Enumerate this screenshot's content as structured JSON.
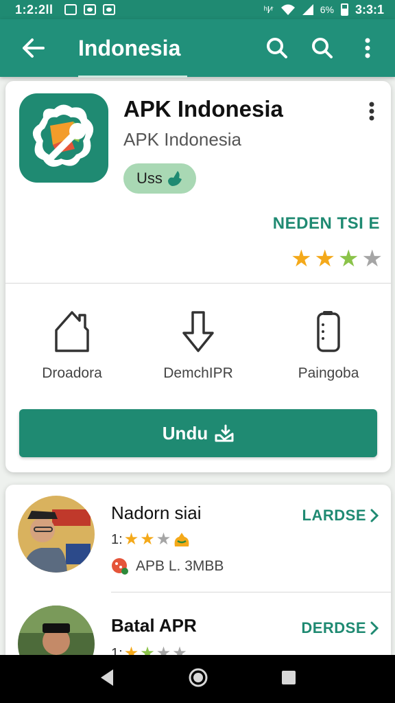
{
  "status_bar": {
    "time": "1:2:2ll",
    "signal_text": "ʰl⁄ʳ",
    "battery_text": "6%",
    "clock_right": "3:3:1"
  },
  "app_bar": {
    "title": "Indonesia"
  },
  "app_card": {
    "name": "APK Indonesia",
    "subtitle": "APK Indonesia",
    "chip_label": "Uss",
    "update_link": "NEDEN TSI E",
    "rating_stars": 3,
    "rating_max": 4,
    "features": [
      {
        "label": "Droadora",
        "icon": "home-icon"
      },
      {
        "label": "DemchIPR",
        "icon": "download-arrow-icon"
      },
      {
        "label": "Paingoba",
        "icon": "phone-icon"
      }
    ],
    "download_button": "Undu"
  },
  "list": {
    "items": [
      {
        "title": "Nadorn siai",
        "rating_prefix": "1:",
        "stars": 2,
        "meta": "APB  L.  3MBB",
        "action": "LARDSE"
      },
      {
        "title": "Batal APR",
        "rating_prefix": "1:",
        "stars": 2,
        "action": "DERDSE"
      }
    ]
  },
  "colors": {
    "primary": "#1f8a72",
    "star_filled": "#f4a91a",
    "star_green": "#8bc34a",
    "star_empty": "#a5a5a5"
  }
}
